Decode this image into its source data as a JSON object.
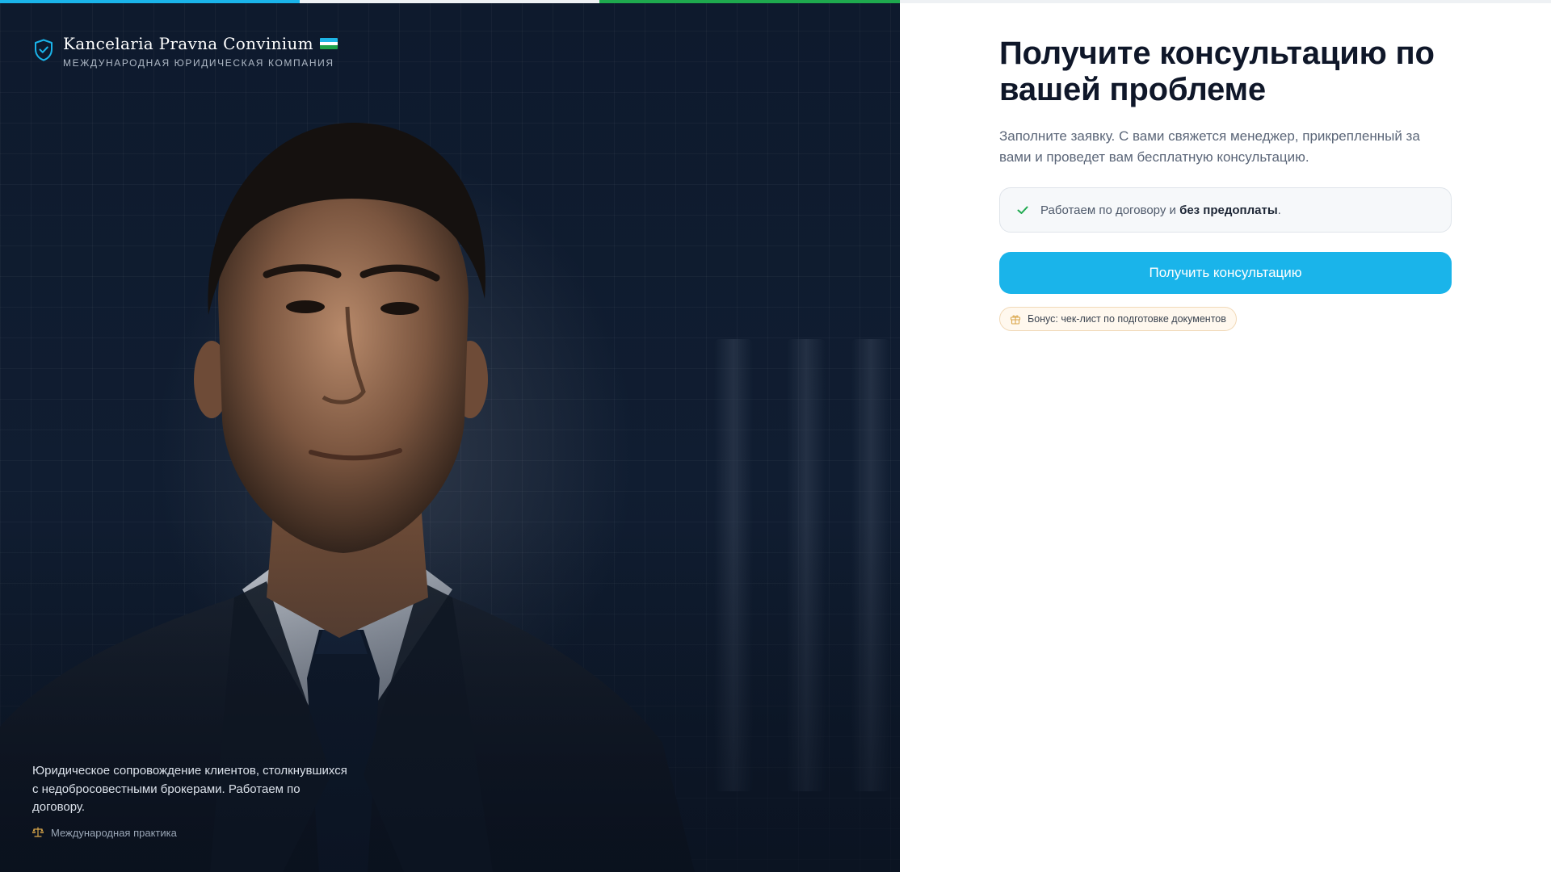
{
  "brand": {
    "title": "Kancelaria Pravna Convinium",
    "subtitle": "МЕЖДУНАРОДНАЯ ЮРИДИЧЕСКАЯ КОМПАНИЯ"
  },
  "hero": {
    "caption": "Юридическое сопровождение клиентов, столкнувшихся с недобросовестными брокерами. Работаем по договору.",
    "tag": "Международная практика"
  },
  "form": {
    "headline": "Получите консультацию  по вашей проблеме",
    "lead": "Заполните заявку. С вами свяжется менеджер, прикрепленный за вами и проведет вам бесплатную консультацию.",
    "notice_prefix": "Работаем по договору и ",
    "notice_bold": "без предоплаты",
    "notice_suffix": ".",
    "cta_label": "Получить консультацию",
    "bonus": "Бонус: чек-лист по подготовке документов"
  },
  "colors": {
    "accent": "#1ab4ea",
    "green": "#1ea94e",
    "hero_bg": "#0e1a2d",
    "headline": "#0f1729"
  },
  "icons": {
    "brand": "shield-check-icon",
    "flag": "uzbekistan-flag-icon",
    "tag": "scales-icon",
    "notice": "check-icon",
    "bonus": "gift-icon"
  }
}
